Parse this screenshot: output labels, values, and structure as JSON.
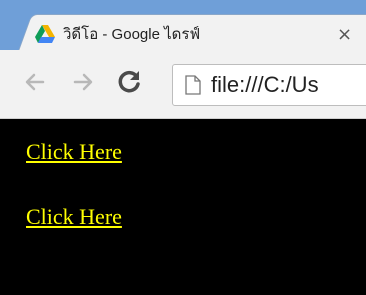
{
  "browser": {
    "tab": {
      "title": "วิดีโอ - Google ไดรฟ์",
      "close_glyph": "×",
      "icon": "google-drive-icon"
    },
    "toolbar": {
      "back_icon": "back-arrow-icon",
      "forward_icon": "forward-arrow-icon",
      "reload_icon": "reload-icon",
      "url": "file:///C:/Us"
    }
  },
  "page": {
    "links": [
      {
        "label": "Click Here"
      },
      {
        "label": "Click Here"
      }
    ],
    "link_color": "#ffff00",
    "background_color": "#000000"
  }
}
